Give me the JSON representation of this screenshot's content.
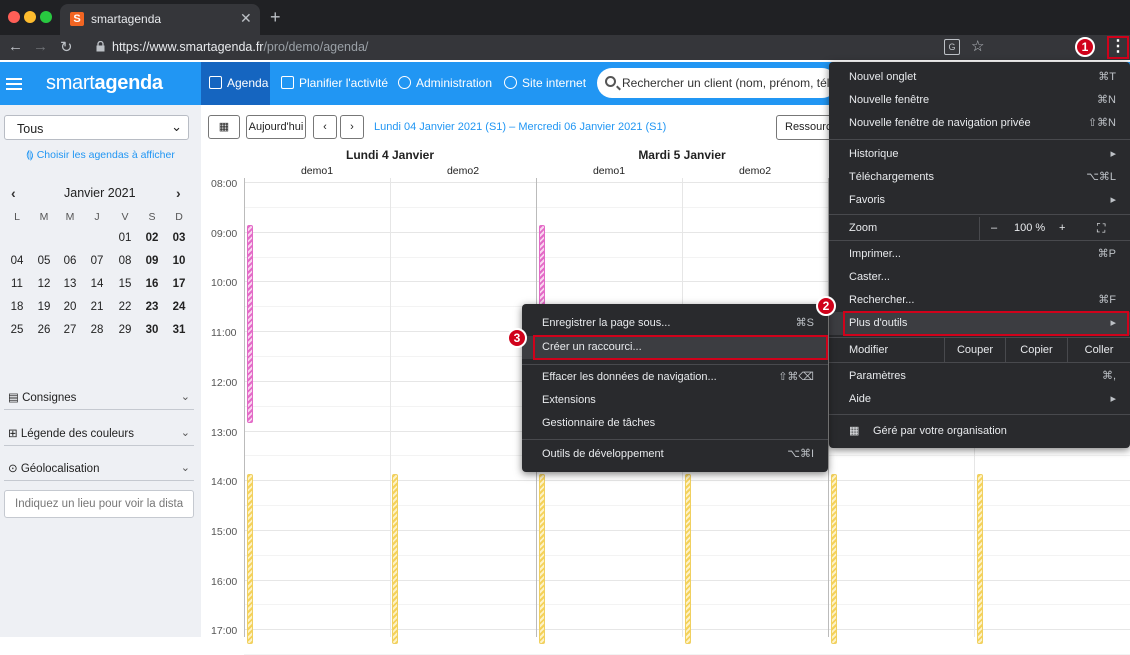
{
  "browser": {
    "tab_title": "smartagenda",
    "favicon_letter": "S",
    "tab_close": "✕",
    "new_tab": "+",
    "url_domain": "https://www.smartagenda.fr",
    "url_path": "/pro/demo/agenda/",
    "kebab": "⋮"
  },
  "header": {
    "logo_light": "smart",
    "logo_bold": "agenda",
    "nav": [
      {
        "label": "Agenda",
        "icon": "calendar-31-icon"
      },
      {
        "label": "Planifier l'activité",
        "icon": "plan-icon"
      },
      {
        "label": "Administration",
        "icon": "gear-icon"
      },
      {
        "label": "Site internet",
        "icon": "globe-icon"
      }
    ],
    "search_placeholder": "Rechercher un client (nom, prénom, téléphone"
  },
  "sidebar": {
    "select_value": "Tous",
    "choose_link": "Choisir les agendas à afficher",
    "month": "Janvier 2021",
    "dow": [
      "L",
      "M",
      "M",
      "J",
      "V",
      "S",
      "D"
    ],
    "weeks": [
      [
        "",
        "",
        "",
        "",
        "01",
        "02",
        "03"
      ],
      [
        "04",
        "05",
        "06",
        "07",
        "08",
        "09",
        "10"
      ],
      [
        "11",
        "12",
        "13",
        "14",
        "15",
        "16",
        "17"
      ],
      [
        "18",
        "19",
        "20",
        "21",
        "22",
        "23",
        "24"
      ],
      [
        "25",
        "26",
        "27",
        "28",
        "29",
        "30",
        "31"
      ]
    ],
    "accordions": [
      "Consignes",
      "Légende des couleurs",
      "Géolocalisation"
    ],
    "location_placeholder": "Indiquez un lieu pour voir la dista"
  },
  "calendar": {
    "today_btn": "Aujourd'hui",
    "date_range": "Lundi 04 Janvier 2021 (S1) – Mercredi 06 Janvier 2021 (S1)",
    "resources_btn": "Ressources",
    "days": [
      "Lundi 4 Janvier",
      "Mardi 5 Janvier"
    ],
    "resources": [
      "demo1",
      "demo2",
      "demo1",
      "demo2"
    ],
    "times": [
      "08:00",
      "09:00",
      "10:00",
      "11:00",
      "12:00",
      "13:00",
      "14:00",
      "15:00",
      "16:00",
      "17:00"
    ]
  },
  "chrome_menu": {
    "items": [
      {
        "label": "Nouvel onglet",
        "shortcut": "⌘T"
      },
      {
        "label": "Nouvelle fenêtre",
        "shortcut": "⌘N"
      },
      {
        "label": "Nouvelle fenêtre de navigation privée",
        "shortcut": "⇧⌘N"
      },
      {
        "label": "Historique",
        "shortcut": "▸"
      },
      {
        "label": "Téléchargements",
        "shortcut": "⌥⌘L"
      },
      {
        "label": "Favoris",
        "shortcut": "▸"
      },
      {
        "label": "Imprimer...",
        "shortcut": "⌘P"
      },
      {
        "label": "Caster...",
        "shortcut": ""
      },
      {
        "label": "Rechercher...",
        "shortcut": "⌘F"
      },
      {
        "label": "Plus d'outils",
        "shortcut": "▸"
      },
      {
        "label": "Paramètres",
        "shortcut": "⌘,"
      },
      {
        "label": "Aide",
        "shortcut": "▸"
      },
      {
        "label": "Géré par votre organisation",
        "shortcut": ""
      }
    ],
    "zoom_label": "Zoom",
    "zoom_minus": "–",
    "zoom_value": "100 %",
    "zoom_plus": "+",
    "edit_label": "Modifier",
    "cut": "Couper",
    "copy": "Copier",
    "paste": "Coller"
  },
  "sub_menu": {
    "items": [
      {
        "label": "Enregistrer la page sous...",
        "shortcut": "⌘S"
      },
      {
        "label": "Créer un raccourci...",
        "shortcut": ""
      },
      {
        "label": "Effacer les données de navigation...",
        "shortcut": "⇧⌘⌫"
      },
      {
        "label": "Extensions",
        "shortcut": ""
      },
      {
        "label": "Gestionnaire de tâches",
        "shortcut": ""
      },
      {
        "label": "Outils de développement",
        "shortcut": "⌥⌘I"
      }
    ]
  },
  "annotations": [
    "1",
    "2",
    "3"
  ],
  "colors": {
    "brand_blue": "#2196f3",
    "annotation_red": "#d0021b",
    "event_pink": "#e36bc7",
    "event_yellow": "#f5d25a"
  }
}
